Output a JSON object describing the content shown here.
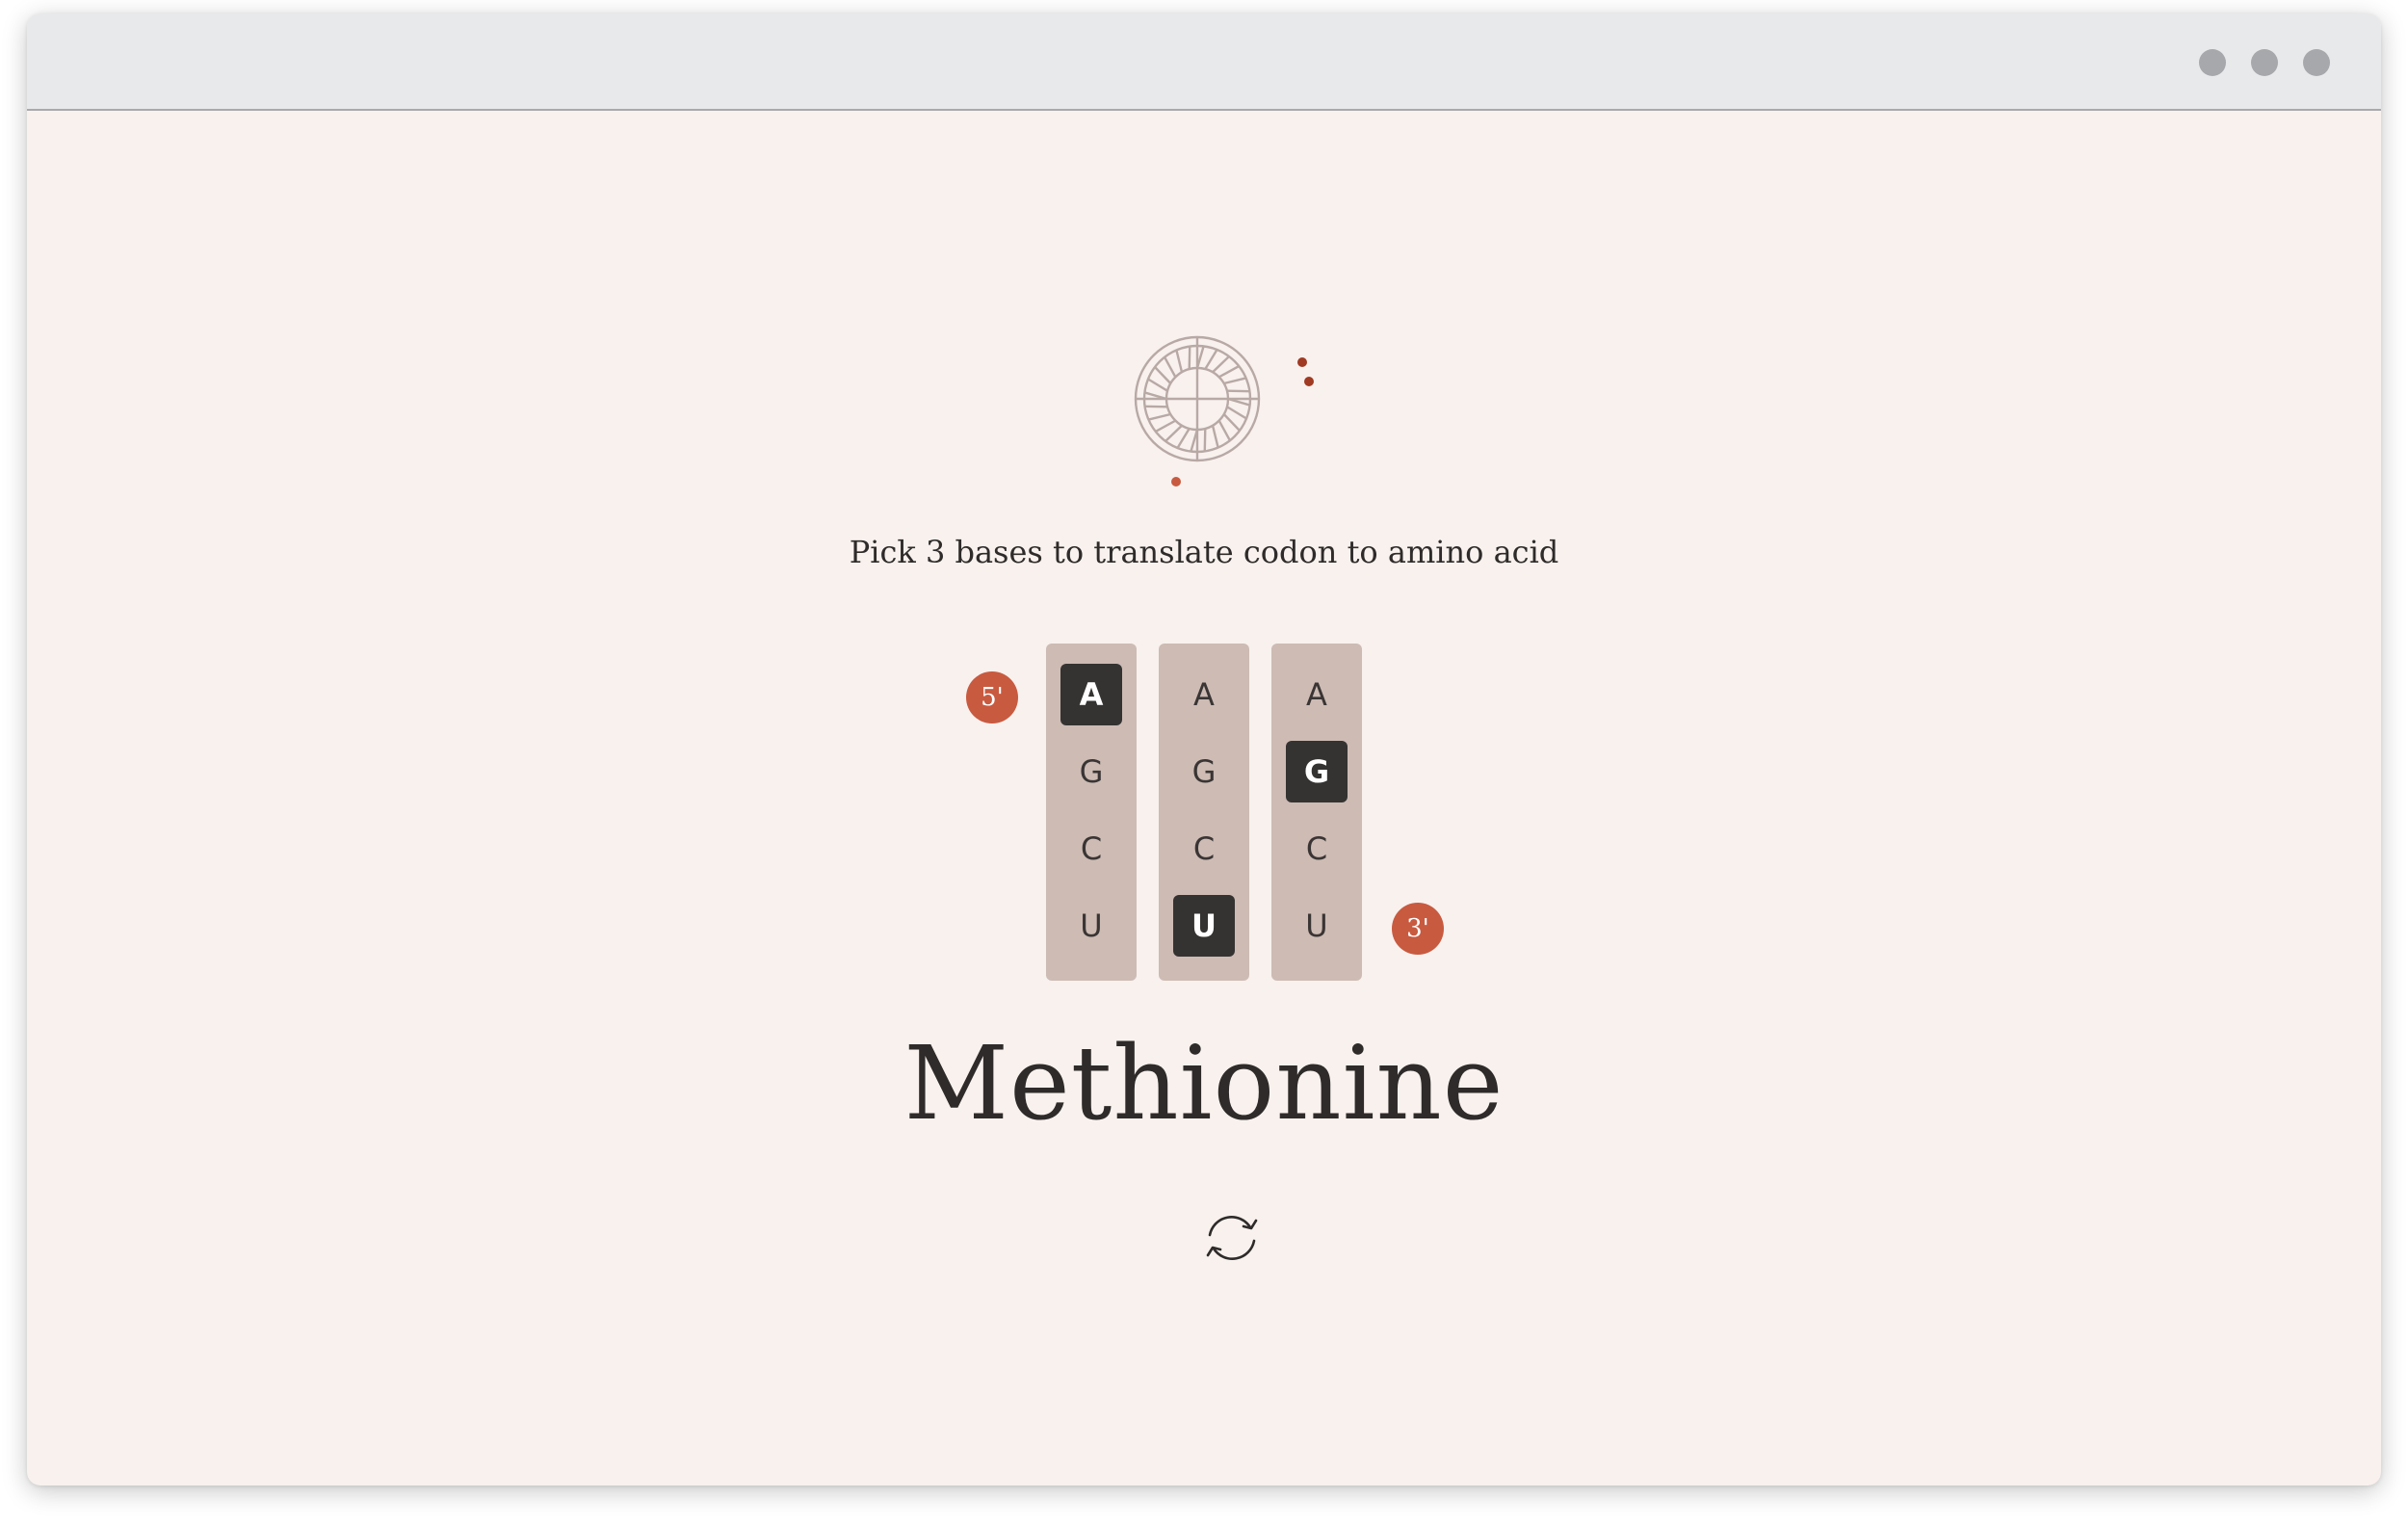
{
  "window": {
    "controls": [
      "dot",
      "dot",
      "dot"
    ]
  },
  "instruction": "Pick 3 bases to translate codon to amino acid",
  "ends": {
    "five_prime": "5'",
    "three_prime": "3'"
  },
  "codon_picker": {
    "bases": [
      "A",
      "G",
      "C",
      "U"
    ],
    "columns": [
      {
        "bases": [
          "A",
          "G",
          "C",
          "U"
        ],
        "selected": "A"
      },
      {
        "bases": [
          "A",
          "G",
          "C",
          "U"
        ],
        "selected": "U"
      },
      {
        "bases": [
          "A",
          "G",
          "C",
          "U"
        ],
        "selected": "G"
      }
    ]
  },
  "result": {
    "amino_acid": "Methionine"
  },
  "icons": {
    "logo": "ribosome-wheel-icon",
    "refresh": "refresh-icon"
  },
  "colors": {
    "accent": "#c85a40",
    "selected": "#343331",
    "column": "#cdbbb4",
    "background": "#f8f1ee"
  }
}
